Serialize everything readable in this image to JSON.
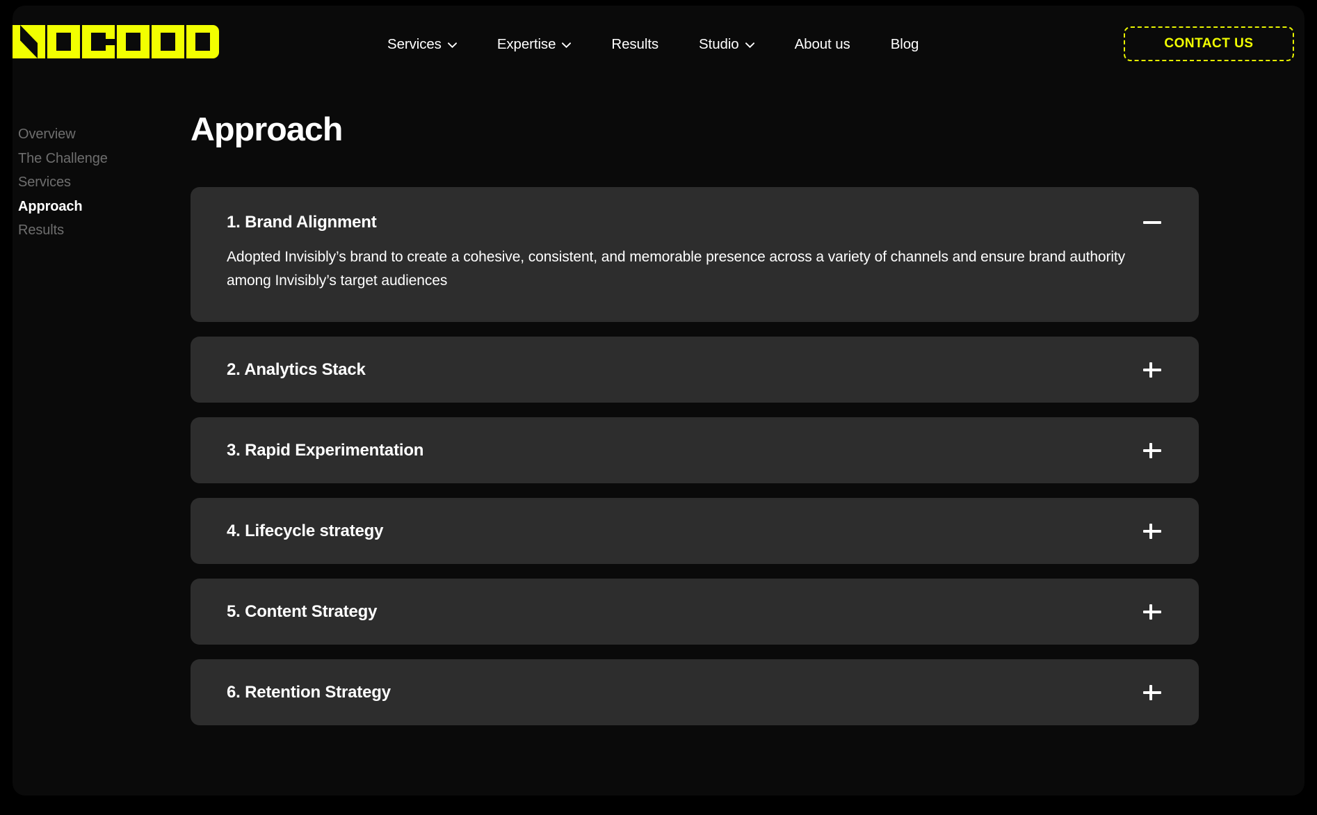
{
  "brand": {
    "logo_text": "NOGOOD",
    "logo_color": "#f2ff00"
  },
  "header": {
    "nav_items": [
      {
        "label": "Services",
        "has_dropdown": true,
        "icon": "chevron-down-icon"
      },
      {
        "label": "Expertise",
        "has_dropdown": true,
        "icon": "chevron-down-icon"
      },
      {
        "label": "Results",
        "has_dropdown": false
      },
      {
        "label": "Studio",
        "has_dropdown": true,
        "icon": "chevron-down-icon"
      },
      {
        "label": "About us",
        "has_dropdown": false
      },
      {
        "label": "Blog",
        "has_dropdown": false
      }
    ],
    "cta": {
      "label": "CONTACT US",
      "border_color": "#e8f400",
      "text_color": "#f2ff00"
    }
  },
  "sidebar": {
    "items": [
      {
        "label": "Overview",
        "active": false
      },
      {
        "label": "The Challenge",
        "active": false
      },
      {
        "label": "Services",
        "active": false
      },
      {
        "label": "Approach",
        "active": true
      },
      {
        "label": "Results",
        "active": false
      }
    ],
    "inactive_color": "#6e6e6e",
    "active_color": "#ffffff"
  },
  "main": {
    "title": "Approach",
    "card_background": "#2d2d2d",
    "cards": [
      {
        "title": "1. Brand Alignment",
        "expanded": true,
        "toggle_icon": "minus-icon",
        "body": "Adopted Invisibly’s brand to create a cohesive, consistent, and memorable presence across a variety of channels and ensure brand authority among Invisibly’s target audiences"
      },
      {
        "title": "2. Analytics Stack",
        "expanded": false,
        "toggle_icon": "plus-icon",
        "body": ""
      },
      {
        "title": "3. Rapid Experimentation",
        "expanded": false,
        "toggle_icon": "plus-icon",
        "body": ""
      },
      {
        "title": "4. Lifecycle strategy",
        "expanded": false,
        "toggle_icon": "plus-icon",
        "body": ""
      },
      {
        "title": "5. Content Strategy",
        "expanded": false,
        "toggle_icon": "plus-icon",
        "body": ""
      },
      {
        "title": "6. Retention Strategy",
        "expanded": false,
        "toggle_icon": "plus-icon",
        "body": ""
      }
    ]
  }
}
